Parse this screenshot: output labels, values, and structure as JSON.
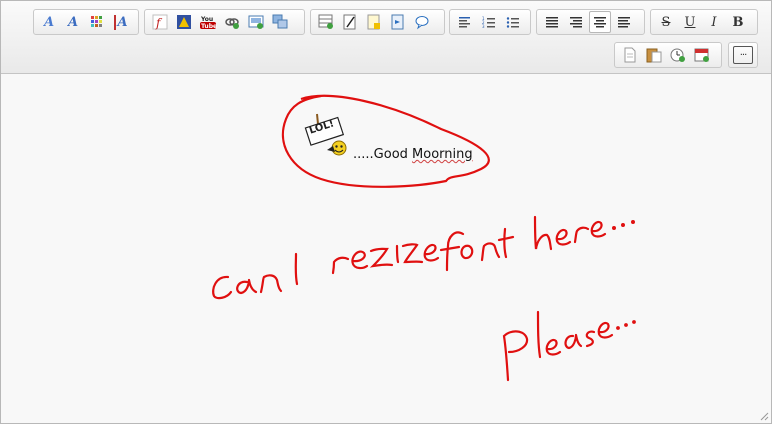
{
  "toolbar": {
    "row1": [
      {
        "name": "font-color-icon",
        "glyph": "A",
        "color": "#4a7bd0"
      },
      {
        "name": "font-style-icon",
        "glyph": "A",
        "color": "#3b6cc0"
      },
      {
        "name": "color-grid-icon",
        "glyph": "▦",
        "color": "#d0a020"
      },
      {
        "name": "remove-format-icon",
        "glyph": "A",
        "color": "#c03030"
      },
      {
        "name": "flash-icon",
        "glyph": "ƒ",
        "color": "#c02020"
      },
      {
        "name": "warning-icon",
        "glyph": "▲",
        "color": "#e0a000"
      },
      {
        "name": "youtube-icon",
        "glyph": "You\nTube",
        "color": "#c00000"
      },
      {
        "name": "link-icon",
        "glyph": "⚭",
        "color": "#444"
      },
      {
        "name": "image-icon",
        "glyph": "▣",
        "color": "#4a7bb0"
      },
      {
        "name": "media-icon",
        "glyph": "▦",
        "color": "#4a7bb0"
      },
      {
        "name": "table-icon",
        "glyph": "▦",
        "color": "#4a8a4a"
      },
      {
        "name": "edit-icon",
        "glyph": "✎",
        "color": "#333"
      },
      {
        "name": "note-icon",
        "glyph": "▤",
        "color": "#c0a020"
      },
      {
        "name": "quote-icon",
        "glyph": "❝",
        "color": "#2a70c0"
      },
      {
        "name": "comment-icon",
        "glyph": "○",
        "color": "#2a70c0"
      },
      {
        "name": "align-left-icon",
        "glyph": "≡",
        "color": "#333"
      },
      {
        "name": "ordered-list-icon",
        "glyph": "☰",
        "color": "#333"
      },
      {
        "name": "unordered-list-icon",
        "glyph": "☰",
        "color": "#333"
      },
      {
        "name": "justify-icon",
        "glyph": "≣",
        "color": "#333"
      },
      {
        "name": "align-right-icon",
        "glyph": "≡",
        "color": "#333"
      },
      {
        "name": "align-center-icon",
        "glyph": "≡",
        "color": "#333",
        "active": true
      },
      {
        "name": "align-full-icon",
        "glyph": "≡",
        "color": "#333"
      }
    ],
    "format": {
      "strike": "S",
      "underline": "U",
      "italic": "I",
      "bold": "B"
    },
    "more_label": "···"
  },
  "content": {
    "greeting": ".....Good Moorning",
    "greeting_prefix": ".....Good ",
    "greeting_word": "Moorning",
    "smiley_sign": "LOL!",
    "handwriting_line1": "Can I rezize font here ...",
    "handwriting_line2": "Please..."
  },
  "colors": {
    "ink": "#e01010",
    "border": "#b8b8b8",
    "toolbar": "#ececec"
  }
}
